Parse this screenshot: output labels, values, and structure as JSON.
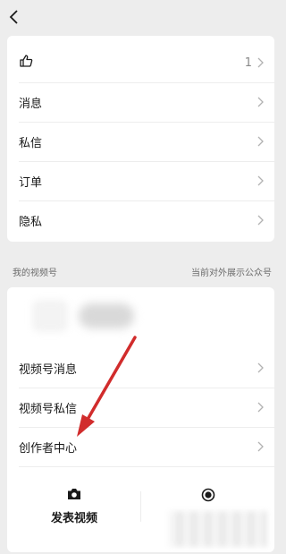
{
  "header": {
    "back_icon": "chevron-left-icon"
  },
  "settings_list": [
    {
      "label": "",
      "icon": "thumbs-up-icon",
      "value": "1"
    },
    {
      "label": "消息",
      "value": ""
    },
    {
      "label": "私信",
      "value": ""
    },
    {
      "label": "订单",
      "value": ""
    },
    {
      "label": "隐私",
      "value": ""
    }
  ],
  "channels_section": {
    "title": "我的视频号",
    "subtitle": "当前对外展示公众号"
  },
  "channels_list": [
    {
      "label": "视频号消息"
    },
    {
      "label": "视频号私信"
    },
    {
      "label": "创作者中心"
    }
  ],
  "actions": {
    "post_video": {
      "label": "发表视频",
      "icon": "camera-icon"
    },
    "live": {
      "label": "",
      "icon": "record-icon"
    }
  },
  "colors": {
    "background": "#ededed",
    "card": "#ffffff",
    "annotation_arrow": "#d12c2c"
  }
}
